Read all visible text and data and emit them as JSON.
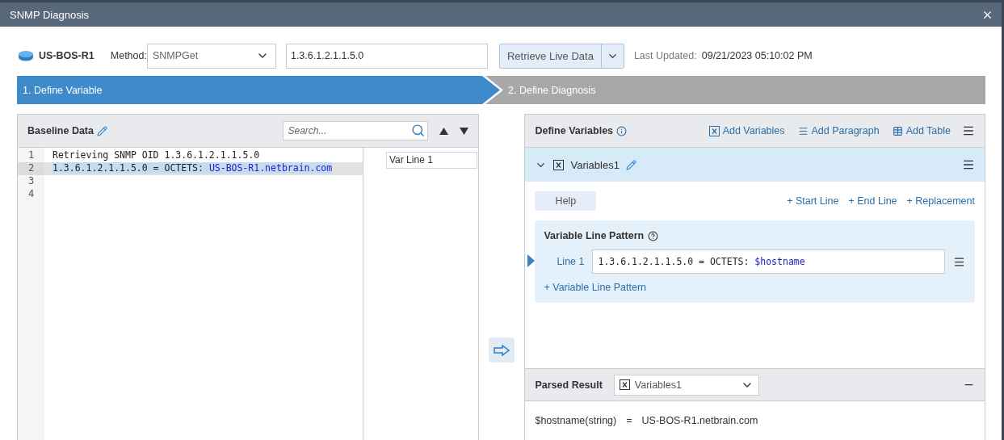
{
  "window": {
    "title": "SNMP Diagnosis"
  },
  "toolbar": {
    "device": "US-BOS-R1",
    "method_label": "Method:",
    "method": "SNMPGet",
    "oid": "1.3.6.1.2.1.1.5.0",
    "retrieve_button": "Retrieve Live Data",
    "last_updated_label": "Last Updated:",
    "last_updated": "09/21/2023 05:10:02 PM"
  },
  "steps": [
    {
      "label": "1. Define Variable",
      "selected": true
    },
    {
      "label": "2. Define Diagnosis",
      "selected": false
    }
  ],
  "baseline": {
    "title": "Baseline Data",
    "search": {
      "placeholder": "Search..."
    },
    "lines": [
      {
        "number": "1",
        "selected": false,
        "segments": [
          {
            "kind": "plain",
            "text": "Retrieving SNMP OID 1.3.6.1.2.1.1.5.0"
          }
        ]
      },
      {
        "number": "2",
        "selected": true,
        "segments": [
          {
            "kind": "plain",
            "text": "1.3.6.1.2.1.1.5.0 = OCTETS: "
          },
          {
            "kind": "value",
            "text": "US-BOS-R1.netbrain.com"
          }
        ]
      },
      {
        "number": "3",
        "selected": false
      },
      {
        "number": "4",
        "selected": false
      }
    ],
    "tags": [
      {
        "label": "Var Line 1"
      }
    ]
  },
  "define": {
    "title": "Define Variables",
    "actions": [
      "Add Variables",
      "Add Paragraph",
      "Add Table"
    ],
    "variable": {
      "name": "Variables1",
      "expanded": true,
      "help_button": "Help",
      "links": [
        "+ Start Line",
        "+ End Line",
        "+ Replacement"
      ],
      "pattern_title": "Variable Line Pattern",
      "pattern_lines": [
        {
          "label": "Line 1",
          "segments": [
            {
              "kind": "plain",
              "text": "1.3.6.1.2.1.1.5.0 = OCTETS: "
            },
            {
              "kind": "variable",
              "text": "$hostname"
            }
          ]
        }
      ],
      "add_pattern": "+ Variable Line Pattern"
    }
  },
  "parsed": {
    "title": "Parsed Result",
    "selector": "Variables1",
    "result": {
      "name": "$hostname(string)",
      "equals": "=",
      "value": "US-BOS-R1.netbrain.com"
    }
  }
}
